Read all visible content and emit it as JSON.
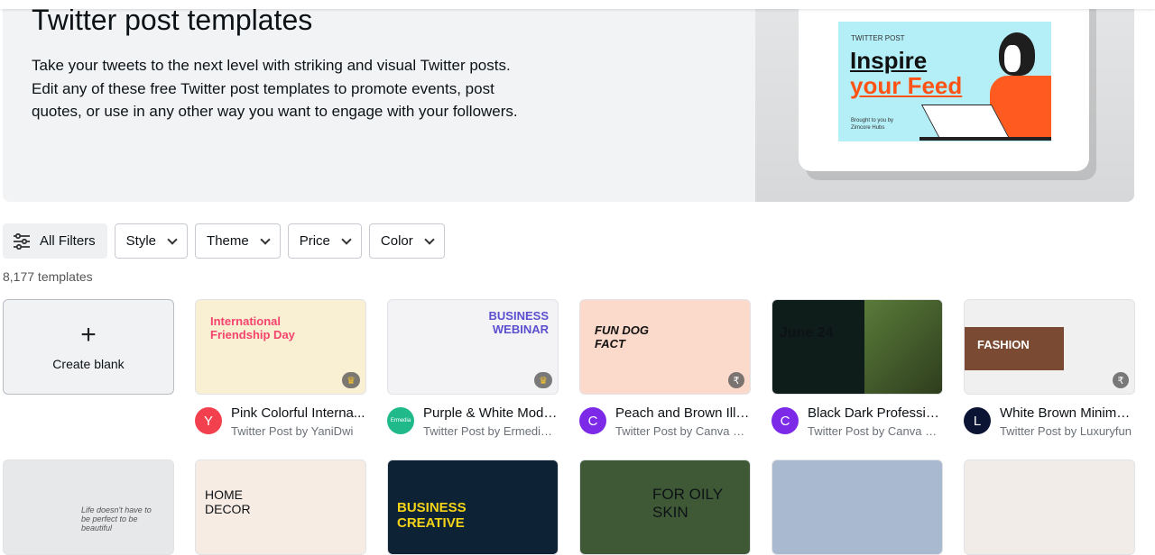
{
  "hero": {
    "title": "Twitter post templates",
    "description": "Take your tweets to the next level with striking and visual Twitter posts. Edit any of these free Twitter post templates to promote events, post quotes, or use in any other way you want to engage with your followers.",
    "preview": {
      "label": "TWITTER POST",
      "line1": "Inspire",
      "line2": "your Feed",
      "credit": "Brought to you by Zimcore Hubs"
    }
  },
  "filters": [
    {
      "label": "All Filters",
      "icon": "sliders-icon"
    },
    {
      "label": "Style"
    },
    {
      "label": "Theme"
    },
    {
      "label": "Price"
    },
    {
      "label": "Color"
    }
  ],
  "count": "8,177 templates",
  "create_blank": {
    "icon": "+",
    "label": "Create blank"
  },
  "templates": [
    {
      "title": "Pink Colorful Interna...",
      "subtitle": "Twitter Post by YaniDwi",
      "avatar": "Y",
      "avatar_color": "#f2404e",
      "badge": "crown",
      "thumb_text": "International Friendship Day",
      "thumb_bg": "#f9f0d4",
      "thumb_color": "#f4436c"
    },
    {
      "title": "Purple & White Mode...",
      "subtitle": "Twitter Post by Ermedia ...",
      "avatar": "Ermedia",
      "avatar_color": "#1fb98a",
      "badge": "crown",
      "thumb_text": "BUSINESS WEBINAR",
      "thumb_bg": "#f3f3f6",
      "thumb_color": "#5b4fd0"
    },
    {
      "title": "Peach and Brown Illu...",
      "subtitle": "Twitter Post by Canva Cr...",
      "avatar": "C",
      "avatar_color": "#7d2ae8",
      "badge": "rupee",
      "thumb_text": "FUN DOG FACT",
      "thumb_bg": "#fbd9cb",
      "thumb_color": "#111"
    },
    {
      "title": "Black Dark Professio...",
      "subtitle": "Twitter Post by Canva Cr...",
      "avatar": "C",
      "avatar_color": "#7d2ae8",
      "badge": "",
      "thumb_text": "June 24",
      "thumb_bg": "#0f1d1a",
      "thumb_color": "#fff"
    },
    {
      "title": "White Brown Minima...",
      "subtitle": "Twitter Post by Luxuryfun",
      "avatar": "L",
      "avatar_color": "#0c1433",
      "badge": "rupee",
      "thumb_text": "FASHION",
      "thumb_bg": "#f0f0f0",
      "thumb_color": "#fff"
    }
  ],
  "row2": [
    {
      "thumb_text": "Life doesn't have to be perfect to be beautiful",
      "thumb_bg": "#e6e8ea",
      "thumb_color": "#555"
    },
    {
      "thumb_text": "HOME DECOR",
      "thumb_bg": "#f7ece4",
      "thumb_color": "#5a3b2a"
    },
    {
      "thumb_text": "BUSINESS CREATIVE",
      "thumb_bg": "#0e2236",
      "thumb_color": "#f5d418"
    },
    {
      "thumb_text": "FOR OILY SKIN",
      "thumb_bg": "#3f5936",
      "thumb_color": "#f3efe2"
    },
    {
      "thumb_text": "",
      "thumb_bg": "#a9b9d0",
      "thumb_color": "#fff"
    },
    {
      "thumb_text": "",
      "thumb_bg": "#f1ece7",
      "thumb_color": "#333"
    }
  ]
}
